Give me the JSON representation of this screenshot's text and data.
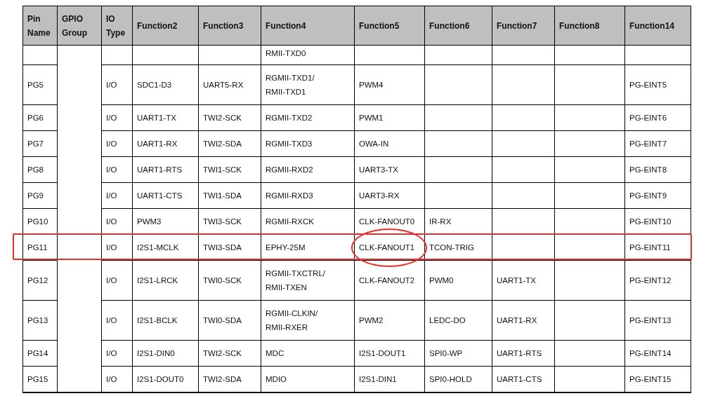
{
  "table": {
    "columns": [
      "Pin Name",
      "GPIO Group",
      "IO Type",
      "Function2",
      "Function3",
      "Function4",
      "Function5",
      "Function6",
      "Function7",
      "Function8",
      "Function14"
    ],
    "rows": [
      {
        "highlighted": false,
        "cells": [
          null,
          null,
          null,
          null,
          null,
          "RMII-TXD0",
          null,
          null,
          null,
          null,
          null
        ]
      },
      {
        "highlighted": false,
        "cells": [
          "PG5",
          null,
          "I/O",
          "SDC1-D3",
          "UART5-RX",
          "RGMII-TXD1/\nRMII-TXD1",
          "PWM4",
          null,
          null,
          null,
          "PG-EINT5"
        ]
      },
      {
        "highlighted": false,
        "cells": [
          "PG6",
          null,
          "I/O",
          "UART1-TX",
          "TWI2-SCK",
          "RGMII-TXD2",
          "PWM1",
          null,
          null,
          null,
          "PG-EINT6"
        ]
      },
      {
        "highlighted": false,
        "cells": [
          "PG7",
          null,
          "I/O",
          "UART1-RX",
          "TWI2-SDA",
          "RGMII-TXD3",
          "OWA-IN",
          null,
          null,
          null,
          "PG-EINT7"
        ]
      },
      {
        "highlighted": false,
        "cells": [
          "PG8",
          null,
          "I/O",
          "UART1-RTS",
          "TWI1-SCK",
          "RGMII-RXD2",
          "UART3-TX",
          null,
          null,
          null,
          "PG-EINT8"
        ]
      },
      {
        "highlighted": false,
        "cells": [
          "PG9",
          null,
          "I/O",
          "UART1-CTS",
          "TWI1-SDA",
          "RGMII-RXD3",
          "UART3-RX",
          null,
          null,
          null,
          "PG-EINT9"
        ]
      },
      {
        "highlighted": false,
        "cells": [
          "PG10",
          null,
          "I/O",
          "PWM3",
          "TWI3-SCK",
          "RGMII-RXCK",
          "CLK-FANOUT0",
          "IR-RX",
          null,
          null,
          "PG-EINT10"
        ]
      },
      {
        "highlighted": true,
        "cells": [
          "PG11",
          null,
          "I/O",
          "I2S1-MCLK",
          "TWI3-SDA",
          "EPHY-25M",
          {
            "text": "CLK-FANOUT1",
            "circled": true
          },
          "TCON-TRIG",
          null,
          null,
          "PG-EINT11"
        ]
      },
      {
        "highlighted": false,
        "cells": [
          "PG12",
          null,
          "I/O",
          "I2S1-LRCK",
          "TWI0-SCK",
          "RGMII-TXCTRL/\nRMII-TXEN",
          "CLK-FANOUT2",
          "PWM0",
          "UART1-TX",
          null,
          "PG-EINT12"
        ]
      },
      {
        "highlighted": false,
        "cells": [
          "PG13",
          null,
          "I/O",
          "I2S1-BCLK",
          "TWI0-SDA",
          "RGMII-CLKIN/\nRMII-RXER",
          "PWM2",
          "LEDC-DO",
          "UART1-RX",
          null,
          "PG-EINT13"
        ]
      },
      {
        "highlighted": false,
        "cells": [
          "PG14",
          null,
          "I/O",
          "I2S1-DIN0",
          "TWI2-SCK",
          "MDC",
          "I2S1-DOUT1",
          "SPI0-WP",
          "UART1-RTS",
          null,
          "PG-EINT14"
        ]
      },
      {
        "highlighted": false,
        "cells": [
          "PG15",
          null,
          "I/O",
          "I2S1-DOUT0",
          "TWI2-SDA",
          "MDIO",
          "I2S1-DIN1",
          "SPI0-HOLD",
          "UART1-CTS",
          null,
          "PG-EINT15"
        ]
      }
    ]
  }
}
